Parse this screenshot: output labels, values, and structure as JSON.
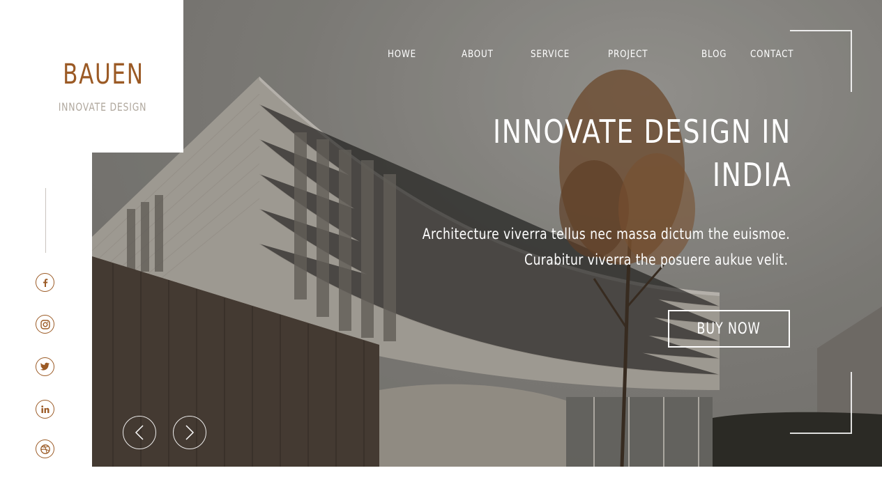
{
  "brand": {
    "name": "BAUEN",
    "tagline": "INNOVATE DESIGN"
  },
  "nav": {
    "items": [
      {
        "label": "HOWE"
      },
      {
        "label": "ABOUT"
      },
      {
        "label": "SERVICE"
      },
      {
        "label": "PROJECT"
      },
      {
        "label": "BLOG"
      },
      {
        "label": "CONTACT"
      }
    ]
  },
  "hero": {
    "headline_line1": "INNOVATE DESIGN IN",
    "headline_line2": "INDIA",
    "subtext_line1": "Architecture viverra tellus nec massa dictum the euismoe.",
    "subtext_line2": "Curabitur viverra the posuere aukue velit.",
    "cta_label": "BUY NOW"
  },
  "social": [
    {
      "icon": "facebook-icon"
    },
    {
      "icon": "instagram-icon"
    },
    {
      "icon": "twitter-icon"
    },
    {
      "icon": "linkedin-icon"
    },
    {
      "icon": "dribbble-icon"
    }
  ],
  "slider": {
    "prev_icon": "chevron-left-icon",
    "next_icon": "chevron-right-icon"
  },
  "colors": {
    "accent": "#9b5a25",
    "tagline": "#b0a89e",
    "hero_text": "#ffffff"
  }
}
